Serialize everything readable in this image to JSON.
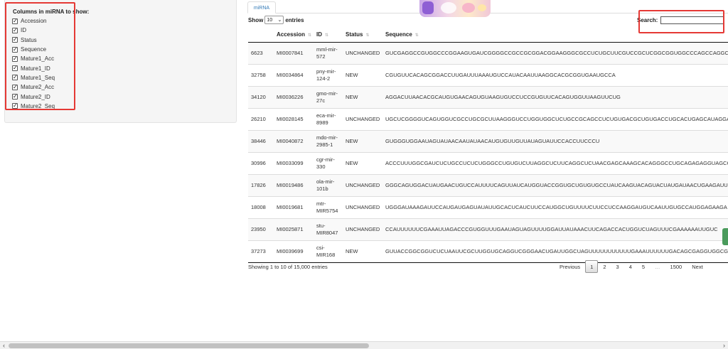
{
  "sidebar": {
    "title": "Columns in miRNA to show:",
    "columns": [
      "Accession",
      "ID",
      "Status",
      "Sequence",
      "Mature1_Acc",
      "Mature1_ID",
      "Mature1_Seq",
      "Mature2_Acc",
      "Mature2_ID",
      "Mature2_Seq"
    ]
  },
  "tabs": [
    {
      "label": "miRNA"
    }
  ],
  "length": {
    "prefix": "Show",
    "value": "10",
    "suffix": "entries"
  },
  "search": {
    "label": "Search:",
    "value": ""
  },
  "table": {
    "headers": [
      "",
      "Accession",
      "ID",
      "Status",
      "Sequence"
    ],
    "rows": [
      [
        "6623",
        "MI0007841",
        "mml-mir-572",
        "UNCHANGED",
        "GUCGAGGCCGUGGCCCGGAAGUGAUCGGGGCCGCCGCGGACGGAAGGGCGCCUCUGCUUCGUCCGCUCGGCGGUGGCCCAGCCAGGCC"
      ],
      [
        "32758",
        "MI0034864",
        "pny-mir-124-2",
        "NEW",
        "CGUGUUCACAGCGGACCUUGAUUUAAAUGUCCAUACAAUUAAGGCACGCGGUGAAUGCCA"
      ],
      [
        "34120",
        "MI0036226",
        "gmo-mir-27c",
        "NEW",
        "AGGACUUAACACGCAUGUGAACAGUGUAAGUGUCCUCCGUGUUCACAGUGGUUAAGUUCUG"
      ],
      [
        "26210",
        "MI0028145",
        "eca-mir-8989",
        "UNCHANGED",
        "UGCUCGGGGUCAGUGGUCGCCUGCGCUUAAGGGUCCUGGUGGCUCUGCCGCAGCCUCUGUGACGCUGUGACCUGCACUGAGCAUAGGA"
      ],
      [
        "38446",
        "MI0040872",
        "mdo-mir-2985-1",
        "NEW",
        "GUGGGUGGAAUAGUAUAACAAUAUAACAUGUGUUGUUAUAGUAUUCCACCUUCCCU"
      ],
      [
        "30996",
        "MI0033099",
        "cgr-mir-330",
        "NEW",
        "ACCCUUUGGCGAUCUCUGCCUCUCUGGGCCUGUGUCUUAGGCUCUUCAGGCUCUAACGAGCAAAGCACAGGGCCUGCAGAGAGGUAGCG"
      ],
      [
        "17826",
        "MI0019486",
        "ola-mir-101b",
        "UNCHANGED",
        "GGGCAGUGGACUAUGAACUGUCCAUUUUCAGUUAUCAUGGUACCGGUGCUGUGUGCCUAUCAAGUACAGUACUAUGAUAACUGAAGAUU"
      ],
      [
        "18008",
        "MI0019681",
        "mtr-MIR5754",
        "UNCHANGED",
        "UGGGAUAAAGAUUCCAUGAUGAGUAUAUUGCACUCAUCUUCCAUGGCUGUUUUCUUCCUCCAAGGAUGUCAAUUGUGCCAUGGAGAAGA"
      ],
      [
        "23950",
        "MI0025871",
        "stu-MIR8047",
        "UNCHANGED",
        "CCAUUUUUUCGAAAUUAGACCCGUGGUUUGAAUAGUAGUUUUGGAUUAUAAACUUCAGACCACUGGUCUAGUUUCGAAAAAAUUGUC"
      ],
      [
        "37273",
        "MI0039699",
        "csi-MIR168",
        "NEW",
        "GUUACCGGCGGUCUCUAAUUCGCUUGGUGCAGGUCGGGAACUGAUUGGCUAGUUUUUUUUUUUGAAAUUUUUUGACAGCGAGGUGGCGUG"
      ]
    ]
  },
  "info": "Showing 1 to 10 of 15,000 entries",
  "pagination": {
    "previous": "Previous",
    "pages": [
      "1",
      "2",
      "3",
      "4",
      "5",
      "…",
      "1500"
    ],
    "current": "1",
    "next": "Next"
  },
  "colors": {
    "highlight": "#e53935",
    "link": "#337ab7",
    "green_tab": "#4a9b5c"
  },
  "icons": [
    "checkbox-checked-icon",
    "sort-arrows-icon",
    "chevron-down-icon",
    "scroll-left-icon",
    "scroll-right-icon"
  ]
}
